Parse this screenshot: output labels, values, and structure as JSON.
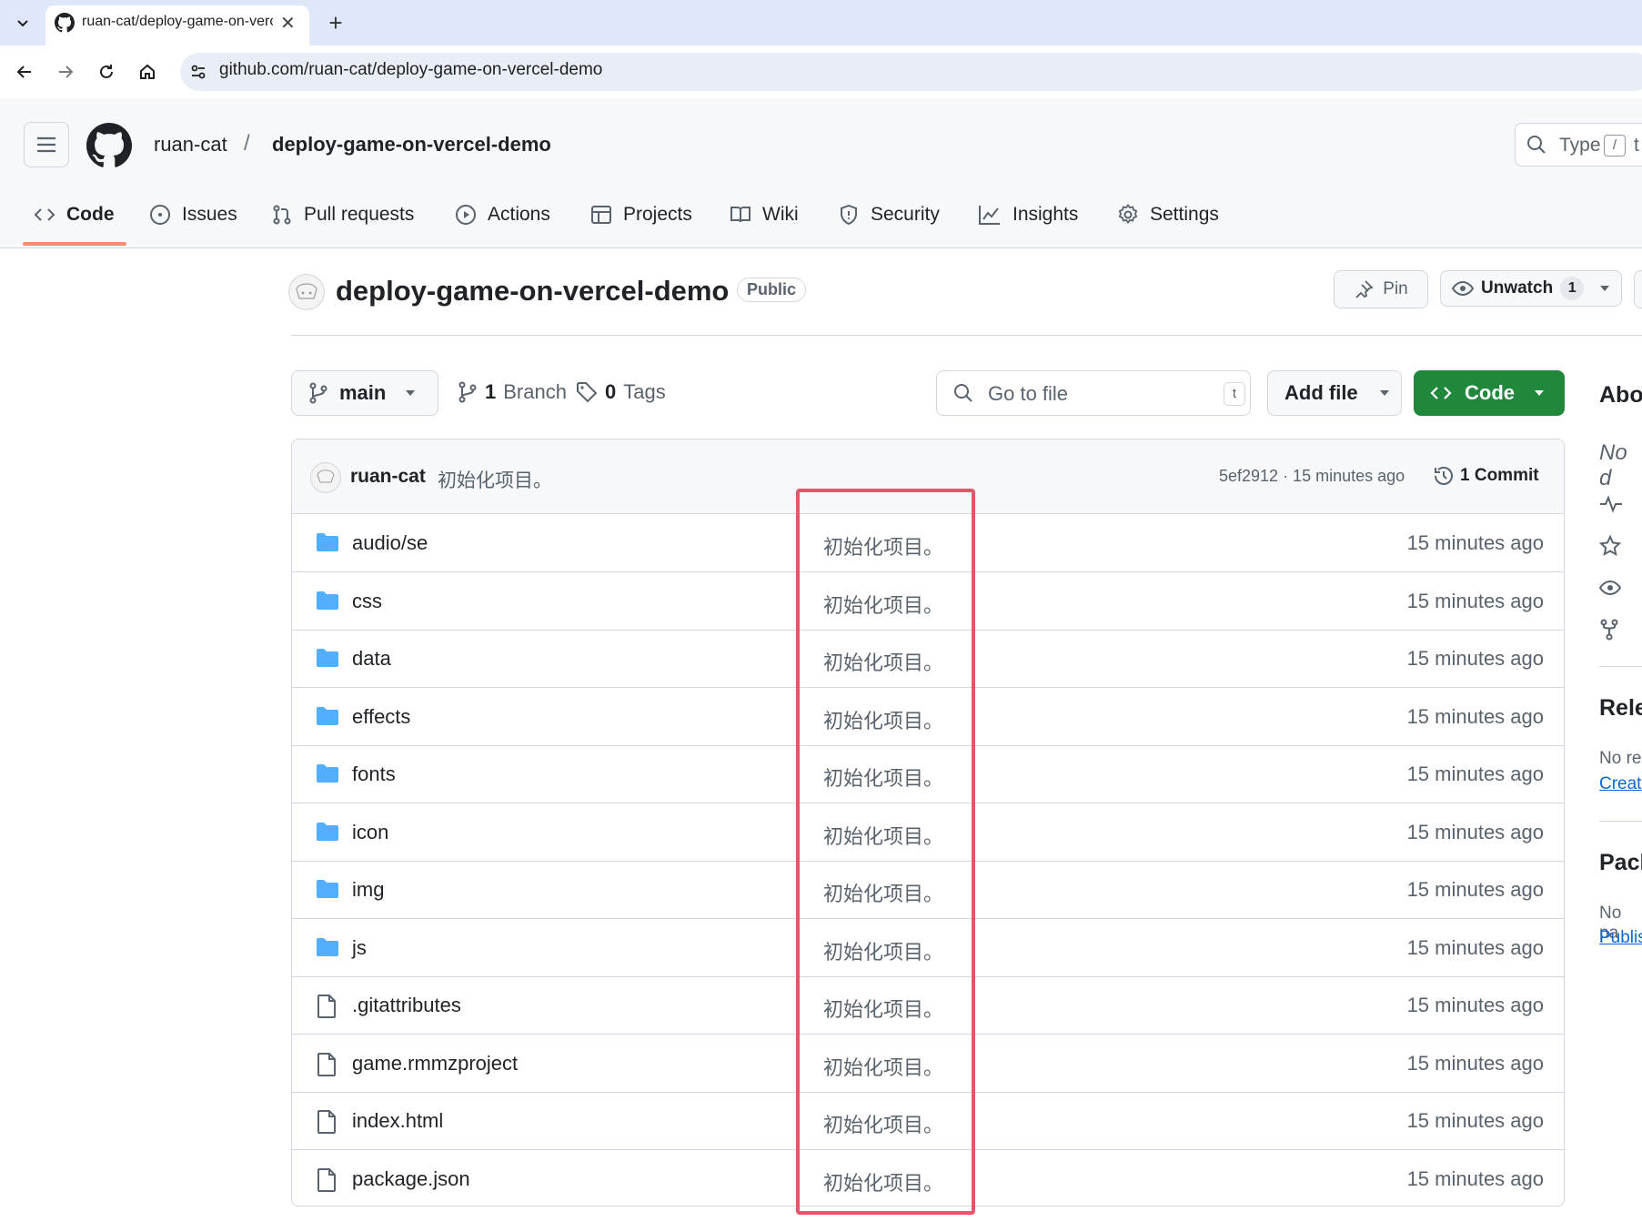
{
  "browser": {
    "tab_title": "ruan-cat/deploy-game-on-vercel-demo",
    "url": "github.com/ruan-cat/deploy-game-on-vercel-demo",
    "close_glyph": "✕",
    "new_tab_glyph": "+"
  },
  "header": {
    "owner": "ruan-cat",
    "separator": "/",
    "repo": "deploy-game-on-vercel-demo",
    "search_placeholder": "Type",
    "search_key": "/",
    "search_tail": "t"
  },
  "repo_tabs": [
    {
      "label": "Code",
      "icon": "code-icon",
      "active": true
    },
    {
      "label": "Issues",
      "icon": "issue-icon"
    },
    {
      "label": "Pull requests",
      "icon": "pull-request-icon"
    },
    {
      "label": "Actions",
      "icon": "play-icon"
    },
    {
      "label": "Projects",
      "icon": "table-icon"
    },
    {
      "label": "Wiki",
      "icon": "book-icon"
    },
    {
      "label": "Security",
      "icon": "shield-icon"
    },
    {
      "label": "Insights",
      "icon": "graph-icon"
    },
    {
      "label": "Settings",
      "icon": "gear-icon"
    }
  ],
  "repo": {
    "title": "deploy-game-on-vercel-demo",
    "visibility": "Public",
    "pin_label": "Pin",
    "unwatch_label": "Unwatch",
    "watch_count": "1"
  },
  "branch_bar": {
    "branch": "main",
    "branch_count": "1",
    "branch_label": "Branch",
    "tag_count": "0",
    "tag_label": "Tags",
    "goto_placeholder": "Go to file",
    "goto_key": "t",
    "add_file": "Add file",
    "code": "Code"
  },
  "commit": {
    "author": "ruan-cat",
    "message": "初始化项目。",
    "meta": "5ef2912 · 15 minutes ago",
    "count_label": "1 Commit"
  },
  "files": [
    {
      "name": "audio/se",
      "type": "folder",
      "message": "初始化项目。",
      "time": "15 minutes ago"
    },
    {
      "name": "css",
      "type": "folder",
      "message": "初始化项目。",
      "time": "15 minutes ago"
    },
    {
      "name": "data",
      "type": "folder",
      "message": "初始化项目。",
      "time": "15 minutes ago"
    },
    {
      "name": "effects",
      "type": "folder",
      "message": "初始化项目。",
      "time": "15 minutes ago"
    },
    {
      "name": "fonts",
      "type": "folder",
      "message": "初始化项目。",
      "time": "15 minutes ago"
    },
    {
      "name": "icon",
      "type": "folder",
      "message": "初始化项目。",
      "time": "15 minutes ago"
    },
    {
      "name": "img",
      "type": "folder",
      "message": "初始化项目。",
      "time": "15 minutes ago"
    },
    {
      "name": "js",
      "type": "folder",
      "message": "初始化项目。",
      "time": "15 minutes ago"
    },
    {
      "name": ".gitattributes",
      "type": "file",
      "message": "初始化项目。",
      "time": "15 minutes ago"
    },
    {
      "name": "game.rmmzproject",
      "type": "file",
      "message": "初始化项目。",
      "time": "15 minutes ago"
    },
    {
      "name": "index.html",
      "type": "file",
      "message": "初始化项目。",
      "time": "15 minutes ago"
    },
    {
      "name": "package.json",
      "type": "file",
      "message": "初始化项目。",
      "time": "15 minutes ago"
    }
  ],
  "sidebar": {
    "about_title": "Abo",
    "about_desc": "No d",
    "releases_title": "Rele",
    "releases_text": "No re",
    "releases_link": "Create",
    "packages_title": "Pack",
    "packages_text": "No pa",
    "packages_link": "Publis"
  },
  "colors": {
    "accent_green": "#1f883d",
    "tab_underline": "#fd8c73",
    "folder_blue": "#54aeff",
    "highlight_red": "#e5566a",
    "link_blue": "#0969da"
  }
}
